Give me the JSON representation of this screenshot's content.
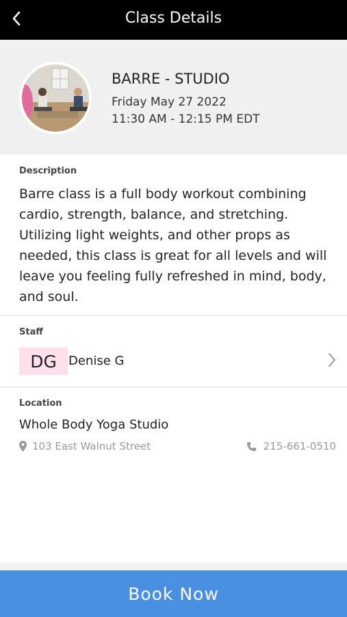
{
  "topbar": {
    "title": "Class Details",
    "back_icon": "chevron-left-icon"
  },
  "class": {
    "name": "BARRE - STUDIO",
    "date": "Friday May 27 2022",
    "time": "11:30 AM - 12:15 PM EDT"
  },
  "description": {
    "label": "Description",
    "text": "Barre class is a full body workout combining cardio, strength, balance, and stretching. Utilizing light weights, and other props as needed, this class is great for all levels and will leave you feeling fully refreshed in mind, body, and soul."
  },
  "staff": {
    "label": "Staff",
    "initials": "DG",
    "name": "Denise G",
    "initials_bg": "#fde0ec"
  },
  "location": {
    "label": "Location",
    "name": "Whole Body Yoga Studio",
    "address": "103 East Walnut Street",
    "phone": "215-661-0510"
  },
  "book_button": {
    "label": "Book Now",
    "color": "#4a90e2"
  }
}
